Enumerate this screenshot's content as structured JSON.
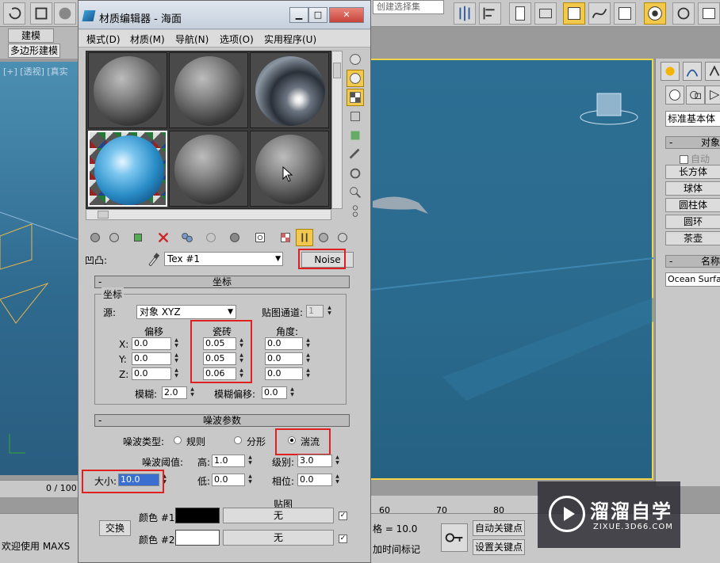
{
  "background": {
    "top_selection_set": "创建选择集",
    "ribbon_tab": "建模",
    "ribbon_sub": "多边形建模",
    "viewport_label": "[+] [透视] [真实",
    "right_panel": {
      "category": "标准基本体",
      "rollout_object_type": "对象",
      "autogrid": "自动",
      "buttons": [
        "长方体",
        "球体",
        "圆柱体",
        "圆环",
        "茶壶"
      ],
      "rollout_name": "名称",
      "name_value": "Ocean Surfac"
    },
    "timeline_text": "0 / 100",
    "timeline_ticks": [
      "60",
      "70",
      "80"
    ],
    "status_text": "欢迎使用 MAXS",
    "status_frame": "格 = 10.0",
    "status_time_tag": "加时间标记",
    "auto_key": "自动关键点",
    "set_key": "设置关键点",
    "accent": "#f2d44a"
  },
  "window": {
    "title": "材质编辑器 - 海面",
    "min": "▁",
    "max": "□",
    "close": "✕",
    "menus": [
      "模式(D)",
      "材质(M)",
      "导航(N)",
      "选项(O)",
      "实用程序(U)"
    ]
  },
  "map_row": {
    "label": "凹凸:",
    "tex_name": "Tex #1",
    "map_type": "Noise"
  },
  "coords": {
    "header": "坐标",
    "group_title": "坐标",
    "source_label": "源:",
    "source_value": "对象 XYZ",
    "map_channel_label": "贴图通道:",
    "map_channel_value": "1",
    "offset_label": "偏移",
    "tiling_label": "瓷砖",
    "angle_label": "角度:",
    "axes": [
      "X:",
      "Y:",
      "Z:"
    ],
    "offset": [
      "0.0",
      "0.0",
      "0.0"
    ],
    "tiling": [
      "0.05",
      "0.05",
      "0.06"
    ],
    "angle": [
      "0.0",
      "0.0",
      "0.0"
    ],
    "blur_label": "模糊:",
    "blur_value": "2.0",
    "blur_offset_label": "模糊偏移:",
    "blur_offset_value": "0.0"
  },
  "noise": {
    "header": "噪波参数",
    "type_label": "噪波类型:",
    "types": [
      "规则",
      "分形",
      "湍流"
    ],
    "selected_type": "湍流",
    "threshold_label": "噪波阈值:",
    "high_label": "高:",
    "high_value": "1.0",
    "levels_label": "级别:",
    "levels_value": "3.0",
    "size_label": "大小:",
    "size_value": "10.0",
    "low_label": "低:",
    "low_value": "0.0",
    "phase_label": "相位:",
    "phase_value": "0.0",
    "maps_label": "贴图",
    "swap_label": "交换",
    "color1_label": "颜色 #1",
    "color2_label": "颜色 #2",
    "color1": "#000000",
    "color2": "#ffffff",
    "map1": "无",
    "map2": "无"
  },
  "watermark": {
    "title": "溜溜自学",
    "url": "ZIXUE.3D66.COM"
  }
}
